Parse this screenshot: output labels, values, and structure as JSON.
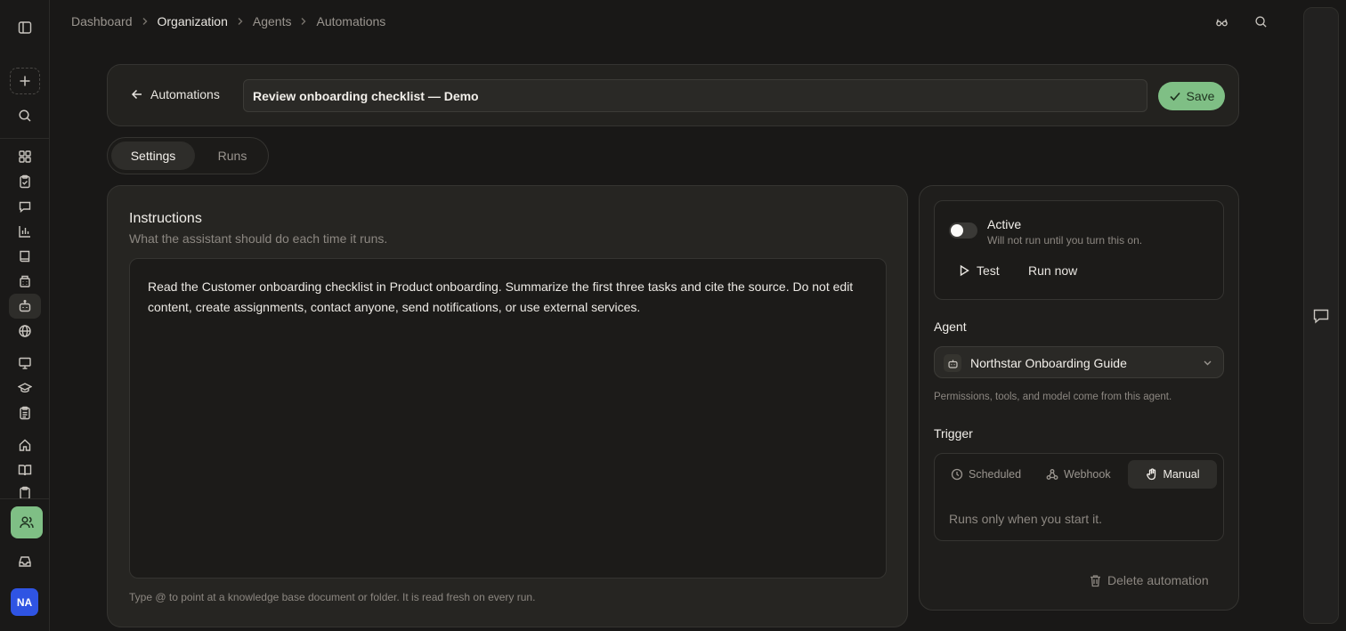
{
  "breadcrumb": {
    "items": [
      "Dashboard",
      "Organization",
      "Agents",
      "Automations"
    ]
  },
  "header": {
    "back_label": "Automations",
    "title_value": "Review onboarding checklist — Demo",
    "save_label": "Save"
  },
  "tabs": {
    "settings": "Settings",
    "runs": "Runs"
  },
  "instructions": {
    "title": "Instructions",
    "subtitle": "What the assistant should do each time it runs.",
    "body": "Read the Customer onboarding checklist in Product onboarding. Summarize the first three tasks and cite the source. Do not edit content, create assignments, contact anyone, send notifications, or use external services.",
    "hint": "Type @ to point at a knowledge base document or folder. It is read fresh on every run."
  },
  "status": {
    "label": "Active",
    "description": "Will not run until you turn this on.",
    "enabled": false,
    "test_label": "Test",
    "run_now_label": "Run now"
  },
  "agent": {
    "section_label": "Agent",
    "selected": "Northstar Onboarding Guide",
    "help": "Permissions, tools, and model come from this agent."
  },
  "trigger": {
    "section_label": "Trigger",
    "options": [
      "Scheduled",
      "Webhook",
      "Manual"
    ],
    "selected": "Manual",
    "description": "Runs only when you start it."
  },
  "delete_label": "Delete automation",
  "user": {
    "initials": "NA"
  },
  "colors": {
    "accent": "#7fbf85",
    "avatar": "#2f54e3",
    "background": "#191817"
  },
  "icons": {
    "rail": [
      "sidebar-toggle-icon",
      "plus-icon",
      "search-icon",
      "dashboard-icon",
      "clipboard-check-icon",
      "message-icon",
      "bar-chart-icon",
      "book-icon",
      "building-icon",
      "bot-icon",
      "globe-icon",
      "presentation-icon",
      "graduation-cap-icon",
      "clipboard-list-icon",
      "home-icon",
      "book-open-icon",
      "clipboard-icon",
      "users-icon",
      "inbox-icon"
    ],
    "top": [
      "glasses-icon",
      "search-icon"
    ]
  }
}
